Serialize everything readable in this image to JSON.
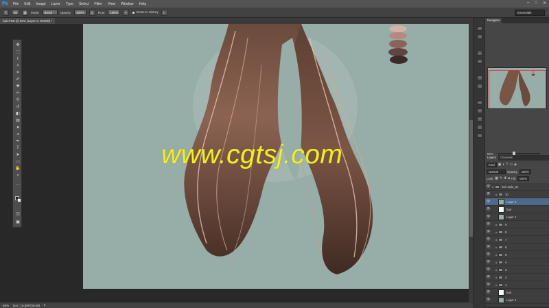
{
  "app": {
    "logo": "Ps"
  },
  "menu": [
    "File",
    "Edit",
    "Image",
    "Layer",
    "Type",
    "Select",
    "Filter",
    "View",
    "Window",
    "Help"
  ],
  "window_controls": [
    "–",
    "□",
    "✕"
  ],
  "options_bar": {
    "brush_size": "30",
    "mode_label": "Mode:",
    "mode_value": "Brush",
    "opacity_label": "Opacity:",
    "opacity_value": "100%",
    "flow_label": "Flow:",
    "flow_value": "100%",
    "erase_history_label": "Erase to History",
    "workspace": "Essentials"
  },
  "document_tab": "hair.PSD @ 50% (Layer 3, RGB/8) *",
  "watermark": "www.cgtsj.com",
  "status": {
    "zoom": "50%",
    "doc": "Doc: 10.3M/706.9M"
  },
  "right_panel": {
    "navigator_tab": "Navigator",
    "navigator_zoom": "50%",
    "layers_tab": "Layers",
    "channels_tab": "Channels",
    "kind_label": "Kind",
    "blend_mode": "Normal",
    "opacity_label": "Opacity:",
    "opacity_value": "100%",
    "lock_label": "Lock:",
    "fill_label": "Fill:",
    "fill_value": "100%"
  },
  "layers": [
    {
      "name": "hair style_01",
      "kind": "group",
      "indent": 0
    },
    {
      "name": "10",
      "kind": "group",
      "indent": 1
    },
    {
      "name": "Layer 3",
      "kind": "layer",
      "indent": 2,
      "selected": true
    },
    {
      "name": "hair",
      "kind": "mask",
      "indent": 2
    },
    {
      "name": "Layer 1",
      "kind": "layer",
      "indent": 2
    },
    {
      "name": "9",
      "kind": "group",
      "indent": 1
    },
    {
      "name": "8",
      "kind": "group",
      "indent": 1
    },
    {
      "name": "7",
      "kind": "group",
      "indent": 1
    },
    {
      "name": "6",
      "kind": "group",
      "indent": 1
    },
    {
      "name": "5",
      "kind": "group",
      "indent": 1
    },
    {
      "name": "4",
      "kind": "group",
      "indent": 1
    },
    {
      "name": "3",
      "kind": "group",
      "indent": 1
    },
    {
      "name": "2",
      "kind": "group",
      "indent": 1
    },
    {
      "name": "1",
      "kind": "group",
      "indent": 1
    },
    {
      "name": "hair",
      "kind": "mask",
      "indent": 2
    },
    {
      "name": "Layer 1",
      "kind": "layer",
      "indent": 2
    }
  ],
  "colors": {
    "canvas_bg": "#97ada8",
    "hair_dark": "#4a3128",
    "hair_light": "#e8c4b0",
    "watermark": "#f2ef1c"
  }
}
